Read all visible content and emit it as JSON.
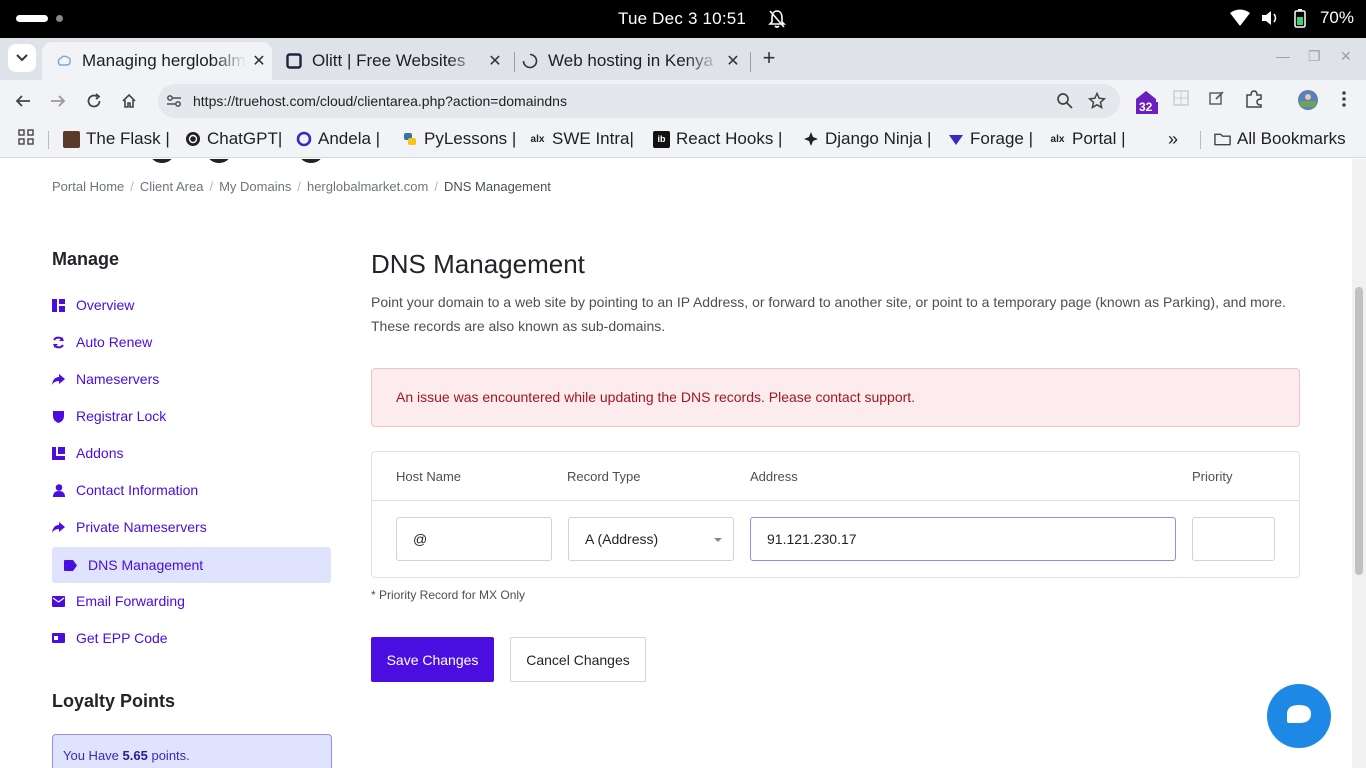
{
  "os": {
    "clock": "Tue Dec 3  10:51",
    "battery": "70%",
    "colors": {
      "bar": "#000000"
    }
  },
  "browser": {
    "tabs": [
      {
        "title": "Managing herglobalmarket.com",
        "icon": "globe-icon",
        "active": true
      },
      {
        "title": "Olitt | Free Websites",
        "icon": "olitt-icon",
        "active": false
      },
      {
        "title": "Web hosting in Kenya",
        "icon": "loading-icon",
        "active": false
      }
    ],
    "url": "https://truehost.com/cloud/clientarea.php?action=domaindns",
    "extension_badge": "32",
    "bookmarks": [
      {
        "label": "The Flask |",
        "icon": "flask-icon"
      },
      {
        "label": "ChatGPT|",
        "icon": "chatgpt-icon"
      },
      {
        "label": "Andela |",
        "icon": "andela-icon"
      },
      {
        "label": "PyLessons |",
        "icon": "python-icon"
      },
      {
        "label": "SWE Intra|",
        "icon": "alx-icon"
      },
      {
        "label": "React Hooks |",
        "icon": "ib-icon"
      },
      {
        "label": "Django Ninja |",
        "icon": "ninja-icon"
      },
      {
        "label": "Forage |",
        "icon": "forage-icon"
      },
      {
        "label": "Portal |",
        "icon": "alx-icon"
      }
    ],
    "all_bookmarks": "All Bookmarks"
  },
  "breadcrumb": [
    "Portal Home",
    "Client Area",
    "My Domains",
    "herglobalmarket.com",
    "DNS Management"
  ],
  "sidebar": {
    "title": "Manage",
    "items": [
      {
        "label": "Overview",
        "icon": "overview-icon"
      },
      {
        "label": "Auto Renew",
        "icon": "sync-icon"
      },
      {
        "label": "Nameservers",
        "icon": "share-arrow-icon"
      },
      {
        "label": "Registrar Lock",
        "icon": "shield-icon"
      },
      {
        "label": "Addons",
        "icon": "cubes-icon"
      },
      {
        "label": "Contact Information",
        "icon": "user-icon"
      },
      {
        "label": "Private Nameservers",
        "icon": "share-arrow-icon"
      },
      {
        "label": "DNS Management",
        "icon": "tag-icon",
        "active": true
      },
      {
        "label": "Email Forwarding",
        "icon": "envelope-icon"
      },
      {
        "label": "Get EPP Code",
        "icon": "id-card-icon"
      }
    ]
  },
  "loyalty": {
    "title": "Loyalty Points",
    "prefix": "You Have",
    "points": "5.65",
    "suffix": "points."
  },
  "main": {
    "title": "DNS Management",
    "description": "Point your domain to a web site by pointing to an IP Address, or forward to another site, or point to a temporary page (known as Parking), and more. These records are also known as sub-domains.",
    "alert": "An issue was encountered while updating the DNS records. Please contact support.",
    "table": {
      "headers": [
        "Host Name",
        "Record Type",
        "Address",
        "Priority"
      ],
      "row": {
        "host": "@",
        "type": "A (Address)",
        "address": "91.121.230.17",
        "priority": ""
      }
    },
    "note": "* Priority Record for MX Only",
    "save_label": "Save Changes",
    "cancel_label": "Cancel Changes"
  },
  "colors": {
    "accent": "#4a0ee0",
    "alert_bg": "#fdecee",
    "alert_text": "#a11724",
    "chat": "#1e88e5"
  }
}
